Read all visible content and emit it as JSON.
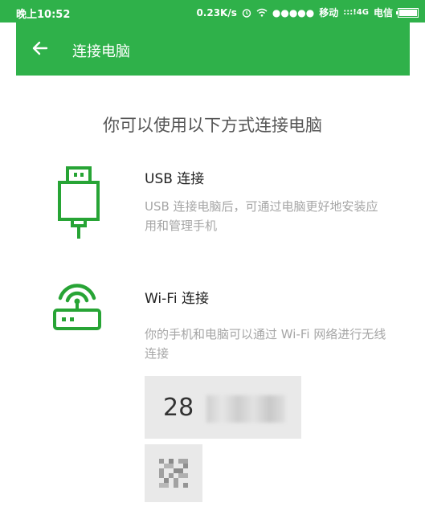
{
  "status_bar": {
    "time": "晚上10:52",
    "speed": "0.23K/s",
    "signal_dots": "●●●●●",
    "carrier1": "移动",
    "net1": ":::!4G",
    "carrier2": "电信"
  },
  "toolbar": {
    "title": "连接电脑"
  },
  "main": {
    "subtitle": "你可以使用以下方式连接电脑"
  },
  "usb": {
    "title": "USB 连接",
    "desc": "USB 连接电脑后，可通过电脑更好地安装应用和管理手机"
  },
  "wifi": {
    "title": "Wi-Fi 连接",
    "desc": "你的手机和电脑可以通过 Wi-Fi 网络进行无线连接",
    "code_prefix": "28"
  },
  "colors": {
    "brand_green": "#2fb14a",
    "icon_green": "#27a435"
  }
}
